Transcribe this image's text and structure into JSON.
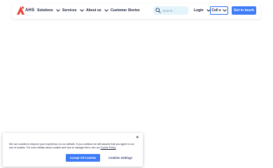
{
  "colors": {
    "brand": "#e5463b",
    "accent": "#3d7bf7",
    "search_bg": "#e3f4fb",
    "text": "#1b1f3b"
  },
  "header": {
    "logo_text": "AHS",
    "nav": [
      {
        "label": "Solutions",
        "icon": "chevron-down-icon"
      },
      {
        "label": "Services",
        "icon": "chevron-down-icon"
      },
      {
        "label": "About us",
        "icon": "chevron-down-icon"
      },
      {
        "label": "Customer Stories"
      }
    ],
    "search": {
      "placeholder": "Search...",
      "icon": "search-icon"
    },
    "login_label": "Login",
    "language_label": "Coll e",
    "cta_label": "Get in touch"
  },
  "cookie_banner": {
    "close_label": "×",
    "text": "We use cookies to improve your experience on our website. If you continue we will assume that you agree to our use of cookies. For more details about cookies and how to manage them, see our",
    "link_label": "Cookie Policy",
    "accept_label": "Accept All Cookies",
    "settings_label": "Cookies Settings"
  }
}
